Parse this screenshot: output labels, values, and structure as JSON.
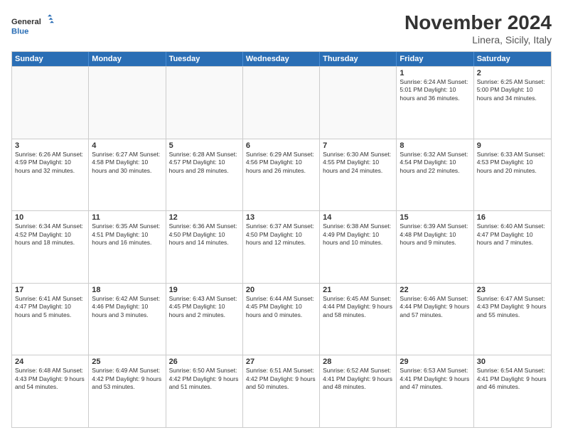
{
  "logo": {
    "line1": "General",
    "line2": "Blue"
  },
  "title": "November 2024",
  "location": "Linera, Sicily, Italy",
  "days_of_week": [
    "Sunday",
    "Monday",
    "Tuesday",
    "Wednesday",
    "Thursday",
    "Friday",
    "Saturday"
  ],
  "weeks": [
    [
      {
        "day": "",
        "info": ""
      },
      {
        "day": "",
        "info": ""
      },
      {
        "day": "",
        "info": ""
      },
      {
        "day": "",
        "info": ""
      },
      {
        "day": "",
        "info": ""
      },
      {
        "day": "1",
        "info": "Sunrise: 6:24 AM\nSunset: 5:01 PM\nDaylight: 10 hours and 36 minutes."
      },
      {
        "day": "2",
        "info": "Sunrise: 6:25 AM\nSunset: 5:00 PM\nDaylight: 10 hours and 34 minutes."
      }
    ],
    [
      {
        "day": "3",
        "info": "Sunrise: 6:26 AM\nSunset: 4:59 PM\nDaylight: 10 hours and 32 minutes."
      },
      {
        "day": "4",
        "info": "Sunrise: 6:27 AM\nSunset: 4:58 PM\nDaylight: 10 hours and 30 minutes."
      },
      {
        "day": "5",
        "info": "Sunrise: 6:28 AM\nSunset: 4:57 PM\nDaylight: 10 hours and 28 minutes."
      },
      {
        "day": "6",
        "info": "Sunrise: 6:29 AM\nSunset: 4:56 PM\nDaylight: 10 hours and 26 minutes."
      },
      {
        "day": "7",
        "info": "Sunrise: 6:30 AM\nSunset: 4:55 PM\nDaylight: 10 hours and 24 minutes."
      },
      {
        "day": "8",
        "info": "Sunrise: 6:32 AM\nSunset: 4:54 PM\nDaylight: 10 hours and 22 minutes."
      },
      {
        "day": "9",
        "info": "Sunrise: 6:33 AM\nSunset: 4:53 PM\nDaylight: 10 hours and 20 minutes."
      }
    ],
    [
      {
        "day": "10",
        "info": "Sunrise: 6:34 AM\nSunset: 4:52 PM\nDaylight: 10 hours and 18 minutes."
      },
      {
        "day": "11",
        "info": "Sunrise: 6:35 AM\nSunset: 4:51 PM\nDaylight: 10 hours and 16 minutes."
      },
      {
        "day": "12",
        "info": "Sunrise: 6:36 AM\nSunset: 4:50 PM\nDaylight: 10 hours and 14 minutes."
      },
      {
        "day": "13",
        "info": "Sunrise: 6:37 AM\nSunset: 4:50 PM\nDaylight: 10 hours and 12 minutes."
      },
      {
        "day": "14",
        "info": "Sunrise: 6:38 AM\nSunset: 4:49 PM\nDaylight: 10 hours and 10 minutes."
      },
      {
        "day": "15",
        "info": "Sunrise: 6:39 AM\nSunset: 4:48 PM\nDaylight: 10 hours and 9 minutes."
      },
      {
        "day": "16",
        "info": "Sunrise: 6:40 AM\nSunset: 4:47 PM\nDaylight: 10 hours and 7 minutes."
      }
    ],
    [
      {
        "day": "17",
        "info": "Sunrise: 6:41 AM\nSunset: 4:47 PM\nDaylight: 10 hours and 5 minutes."
      },
      {
        "day": "18",
        "info": "Sunrise: 6:42 AM\nSunset: 4:46 PM\nDaylight: 10 hours and 3 minutes."
      },
      {
        "day": "19",
        "info": "Sunrise: 6:43 AM\nSunset: 4:45 PM\nDaylight: 10 hours and 2 minutes."
      },
      {
        "day": "20",
        "info": "Sunrise: 6:44 AM\nSunset: 4:45 PM\nDaylight: 10 hours and 0 minutes."
      },
      {
        "day": "21",
        "info": "Sunrise: 6:45 AM\nSunset: 4:44 PM\nDaylight: 9 hours and 58 minutes."
      },
      {
        "day": "22",
        "info": "Sunrise: 6:46 AM\nSunset: 4:44 PM\nDaylight: 9 hours and 57 minutes."
      },
      {
        "day": "23",
        "info": "Sunrise: 6:47 AM\nSunset: 4:43 PM\nDaylight: 9 hours and 55 minutes."
      }
    ],
    [
      {
        "day": "24",
        "info": "Sunrise: 6:48 AM\nSunset: 4:43 PM\nDaylight: 9 hours and 54 minutes."
      },
      {
        "day": "25",
        "info": "Sunrise: 6:49 AM\nSunset: 4:42 PM\nDaylight: 9 hours and 53 minutes."
      },
      {
        "day": "26",
        "info": "Sunrise: 6:50 AM\nSunset: 4:42 PM\nDaylight: 9 hours and 51 minutes."
      },
      {
        "day": "27",
        "info": "Sunrise: 6:51 AM\nSunset: 4:42 PM\nDaylight: 9 hours and 50 minutes."
      },
      {
        "day": "28",
        "info": "Sunrise: 6:52 AM\nSunset: 4:41 PM\nDaylight: 9 hours and 48 minutes."
      },
      {
        "day": "29",
        "info": "Sunrise: 6:53 AM\nSunset: 4:41 PM\nDaylight: 9 hours and 47 minutes."
      },
      {
        "day": "30",
        "info": "Sunrise: 6:54 AM\nSunset: 4:41 PM\nDaylight: 9 hours and 46 minutes."
      }
    ]
  ]
}
